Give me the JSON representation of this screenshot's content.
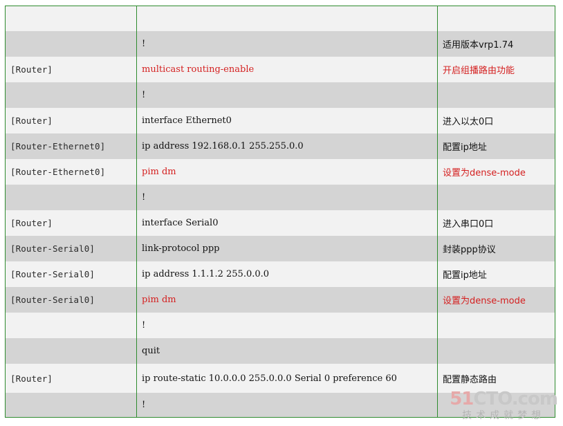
{
  "rows": [
    {
      "prompt": "",
      "command": "",
      "note": "",
      "red": false,
      "bg": "light"
    },
    {
      "prompt": "",
      "command": "!",
      "note": "适用版本vrp1.74",
      "red": false,
      "bg": "dark"
    },
    {
      "prompt": "[Router]",
      "command": "multicast routing-enable",
      "note": "开启组播路由功能",
      "red": true,
      "bg": "light"
    },
    {
      "prompt": "",
      "command": "!",
      "note": "",
      "red": false,
      "bg": "dark"
    },
    {
      "prompt": "[Router]",
      "command": "interface Ethernet0",
      "note": "进入以太0口",
      "red": false,
      "bg": "light"
    },
    {
      "prompt": "[Router-Ethernet0]",
      "command": "ip address 192.168.0.1 255.255.0.0",
      "note": "配置ip地址",
      "red": false,
      "bg": "dark"
    },
    {
      "prompt": "[Router-Ethernet0]",
      "command": "pim dm",
      "note": "设置为dense-mode",
      "red": true,
      "bg": "light"
    },
    {
      "prompt": "",
      "command": "!",
      "note": "",
      "red": false,
      "bg": "dark"
    },
    {
      "prompt": "[Router]",
      "command": "interface Serial0",
      "note": "进入串口0口",
      "red": false,
      "bg": "light"
    },
    {
      "prompt": "[Router-Serial0]",
      "command": "link-protocol ppp",
      "note": "封装ppp协议",
      "red": false,
      "bg": "dark"
    },
    {
      "prompt": "[Router-Serial0]",
      "command": "ip address 1.1.1.2 255.0.0.0",
      "note": "配置ip地址",
      "red": false,
      "bg": "light"
    },
    {
      "prompt": "[Router-Serial0]",
      "command": "pim dm",
      "note": "设置为dense-mode",
      "red": true,
      "bg": "dark"
    },
    {
      "prompt": "",
      "command": "!",
      "note": "",
      "red": false,
      "bg": "light"
    },
    {
      "prompt": "",
      "command": "quit",
      "note": "",
      "red": false,
      "bg": "dark"
    },
    {
      "prompt": "[Router]",
      "command": "ip route-static 10.0.0.0 255.0.0.0 Serial 0 preference 60",
      "note": "配置静态路由",
      "red": false,
      "bg": "light",
      "tall": true
    },
    {
      "prompt": "",
      "command": "!",
      "note": "",
      "red": false,
      "bg": "dark"
    }
  ],
  "watermark": {
    "logo_a": "51",
    "logo_b": "CTO.com",
    "subtitle": "技术成就梦想"
  }
}
